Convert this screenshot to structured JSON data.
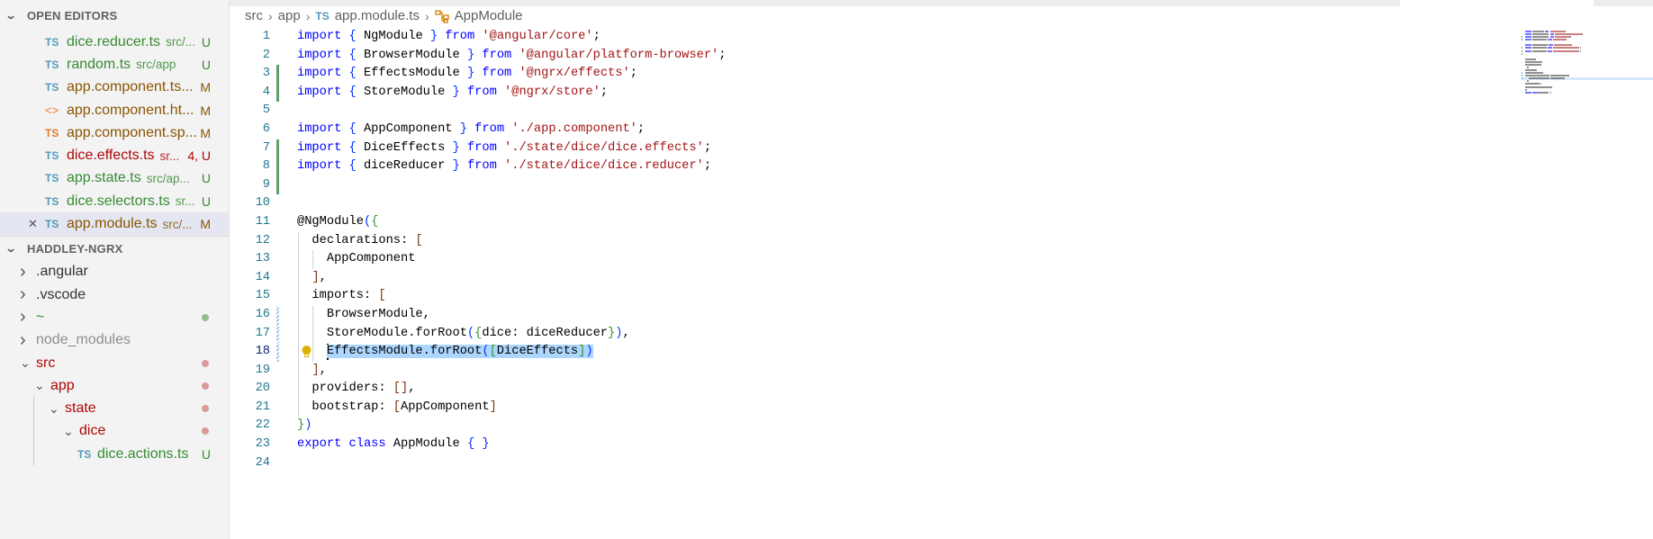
{
  "sidebar": {
    "open_editors_title": "OPEN EDITORS",
    "open_editors": [
      {
        "icon": "ts",
        "name": "dice.reducer.ts",
        "desc": "src/...",
        "badge": "U",
        "color": "green"
      },
      {
        "icon": "ts",
        "name": "random.ts",
        "desc": "src/app",
        "badge": "U",
        "color": "green"
      },
      {
        "icon": "ts",
        "name": "app.component.ts...",
        "desc": "",
        "badge": "M",
        "color": "brown"
      },
      {
        "icon": "html",
        "name": "app.component.ht...",
        "desc": "",
        "badge": "M",
        "color": "brown"
      },
      {
        "icon": "ts-orange",
        "name": "app.component.sp...",
        "desc": "",
        "badge": "M",
        "color": "brown"
      },
      {
        "icon": "ts",
        "name": "dice.effects.ts",
        "desc": "sr...",
        "badge": "4, U",
        "color": "red"
      },
      {
        "icon": "ts",
        "name": "app.state.ts",
        "desc": "src/ap...",
        "badge": "U",
        "color": "green"
      },
      {
        "icon": "ts",
        "name": "dice.selectors.ts",
        "desc": "sr...",
        "badge": "U",
        "color": "green"
      },
      {
        "icon": "ts",
        "name": "app.module.ts",
        "desc": "src/...",
        "badge": "M",
        "color": "brown",
        "active": true
      }
    ],
    "explorer_title": "HADDLEY-NGRX",
    "tree": [
      {
        "name": ".angular",
        "depth": 0,
        "open": false,
        "color": "dark"
      },
      {
        "name": ".vscode",
        "depth": 0,
        "open": false,
        "color": "dark"
      },
      {
        "name": "~",
        "depth": 0,
        "open": false,
        "color": "green",
        "dot": "#8fbf8a"
      },
      {
        "name": "node_modules",
        "depth": 0,
        "open": false,
        "color": "gray"
      },
      {
        "name": "src",
        "depth": 0,
        "open": true,
        "color": "red",
        "dot": "#d99a9a"
      },
      {
        "name": "app",
        "depth": 1,
        "open": true,
        "color": "red",
        "dot": "#d99a9a"
      },
      {
        "name": "state",
        "depth": 2,
        "open": true,
        "color": "red",
        "dot": "#d99a9a"
      },
      {
        "name": "dice",
        "depth": 3,
        "open": true,
        "color": "red",
        "dot": "#d99a9a"
      },
      {
        "name": "dice.actions.ts",
        "depth": 4,
        "file": true,
        "color": "green",
        "badge": "U"
      }
    ]
  },
  "breadcrumb": {
    "parts": [
      "src",
      "app",
      "app.module.ts",
      "AppModule"
    ],
    "file_icon": "TS"
  },
  "editor": {
    "current_line": 18,
    "lines": [
      {
        "t": [
          [
            "import",
            "kw"
          ],
          [
            " ",
            ""
          ],
          [
            "{",
            "br1"
          ],
          [
            " NgModule ",
            "id"
          ],
          [
            "}",
            "br1"
          ],
          [
            " ",
            ""
          ],
          [
            "from",
            "kw"
          ],
          [
            " ",
            ""
          ],
          [
            "'@angular/core'",
            "str"
          ],
          [
            ";",
            "id"
          ]
        ]
      },
      {
        "t": [
          [
            "import",
            "kw"
          ],
          [
            " ",
            ""
          ],
          [
            "{",
            "br1"
          ],
          [
            " BrowserModule ",
            "id"
          ],
          [
            "}",
            "br1"
          ],
          [
            " ",
            ""
          ],
          [
            "from",
            "kw"
          ],
          [
            " ",
            ""
          ],
          [
            "'@angular/platform-browser'",
            "str"
          ],
          [
            ";",
            "id"
          ]
        ]
      },
      {
        "g": "add",
        "t": [
          [
            "import",
            "kw"
          ],
          [
            " ",
            ""
          ],
          [
            "{",
            "br1"
          ],
          [
            " EffectsModule ",
            "id"
          ],
          [
            "}",
            "br1"
          ],
          [
            " ",
            ""
          ],
          [
            "from",
            "kw"
          ],
          [
            " ",
            ""
          ],
          [
            "'@ngrx/effects'",
            "str"
          ],
          [
            ";",
            "id"
          ]
        ]
      },
      {
        "g": "add",
        "t": [
          [
            "import",
            "kw"
          ],
          [
            " ",
            ""
          ],
          [
            "{",
            "br1"
          ],
          [
            " StoreModule ",
            "id"
          ],
          [
            "}",
            "br1"
          ],
          [
            " ",
            ""
          ],
          [
            "from",
            "kw"
          ],
          [
            " ",
            ""
          ],
          [
            "'@ngrx/store'",
            "str"
          ],
          [
            ";",
            "id"
          ]
        ]
      },
      {
        "t": []
      },
      {
        "t": [
          [
            "import",
            "kw"
          ],
          [
            " ",
            ""
          ],
          [
            "{",
            "br1"
          ],
          [
            " AppComponent ",
            "id"
          ],
          [
            "}",
            "br1"
          ],
          [
            " ",
            ""
          ],
          [
            "from",
            "kw"
          ],
          [
            " ",
            ""
          ],
          [
            "'./app.component'",
            "str"
          ],
          [
            ";",
            "id"
          ]
        ]
      },
      {
        "g": "add",
        "t": [
          [
            "import",
            "kw"
          ],
          [
            " ",
            ""
          ],
          [
            "{",
            "br1"
          ],
          [
            " DiceEffects ",
            "id"
          ],
          [
            "}",
            "br1"
          ],
          [
            " ",
            ""
          ],
          [
            "from",
            "kw"
          ],
          [
            " ",
            ""
          ],
          [
            "'./state/dice/dice.effects'",
            "str"
          ],
          [
            ";",
            "id"
          ]
        ]
      },
      {
        "g": "add",
        "t": [
          [
            "import",
            "kw"
          ],
          [
            " ",
            ""
          ],
          [
            "{",
            "br1"
          ],
          [
            " diceReducer ",
            "id"
          ],
          [
            "}",
            "br1"
          ],
          [
            " ",
            ""
          ],
          [
            "from",
            "kw"
          ],
          [
            " ",
            ""
          ],
          [
            "'./state/dice/dice.reducer'",
            "str"
          ],
          [
            ";",
            "id"
          ]
        ]
      },
      {
        "g": "add",
        "t": []
      },
      {
        "t": []
      },
      {
        "t": [
          [
            "@NgModule",
            "id"
          ],
          [
            "(",
            "br1"
          ],
          [
            "{",
            "br2"
          ]
        ]
      },
      {
        "t": [
          [
            "  declarations: ",
            "id"
          ],
          [
            "[",
            "br3"
          ]
        ]
      },
      {
        "t": [
          [
            "    AppComponent",
            "id"
          ]
        ]
      },
      {
        "t": [
          [
            "  ",
            "id"
          ],
          [
            "]",
            "br3"
          ],
          [
            ",",
            "id"
          ]
        ]
      },
      {
        "t": [
          [
            "  imports: ",
            "id"
          ],
          [
            "[",
            "br3"
          ]
        ]
      },
      {
        "g": "mod",
        "t": [
          [
            "    BrowserModule,",
            "id"
          ]
        ]
      },
      {
        "g": "mod",
        "t": [
          [
            "    StoreModule.forRoot",
            "id"
          ],
          [
            "(",
            "br1"
          ],
          [
            "{",
            "br2"
          ],
          [
            "dice: diceReducer",
            "id"
          ],
          [
            "}",
            "br2"
          ],
          [
            ")",
            "br1"
          ],
          [
            ",",
            "id"
          ]
        ]
      },
      {
        "g": "mod",
        "bulb": true,
        "sel": true,
        "t": [
          [
            "    ",
            ""
          ],
          [
            "EffectsModule.forRoot",
            "id"
          ],
          [
            "(",
            "br1"
          ],
          [
            "[",
            "br2"
          ],
          [
            "DiceEffects",
            "id"
          ],
          [
            "]",
            "br2"
          ],
          [
            ")",
            "br1"
          ]
        ]
      },
      {
        "t": [
          [
            "  ",
            "id"
          ],
          [
            "]",
            "br3"
          ],
          [
            ",",
            "id"
          ]
        ]
      },
      {
        "t": [
          [
            "  providers: ",
            "id"
          ],
          [
            "[]",
            "br3"
          ],
          [
            ",",
            "id"
          ]
        ]
      },
      {
        "t": [
          [
            "  bootstrap: ",
            "id"
          ],
          [
            "[",
            "br3"
          ],
          [
            "AppComponent",
            "id"
          ],
          [
            "]",
            "br3"
          ]
        ]
      },
      {
        "t": [
          [
            "}",
            "br2"
          ],
          [
            ")",
            "br1"
          ]
        ]
      },
      {
        "t": [
          [
            "export",
            "kw"
          ],
          [
            " ",
            ""
          ],
          [
            "class",
            "kw"
          ],
          [
            " AppModule ",
            "id"
          ],
          [
            "{",
            "br1"
          ],
          [
            " ",
            ""
          ],
          [
            "}",
            "br1"
          ]
        ]
      },
      {
        "t": []
      }
    ]
  },
  "colors": {
    "accent": "#0000ff",
    "string": "#a31515",
    "added": "#5f9f6a",
    "selection": "#add6ff"
  }
}
